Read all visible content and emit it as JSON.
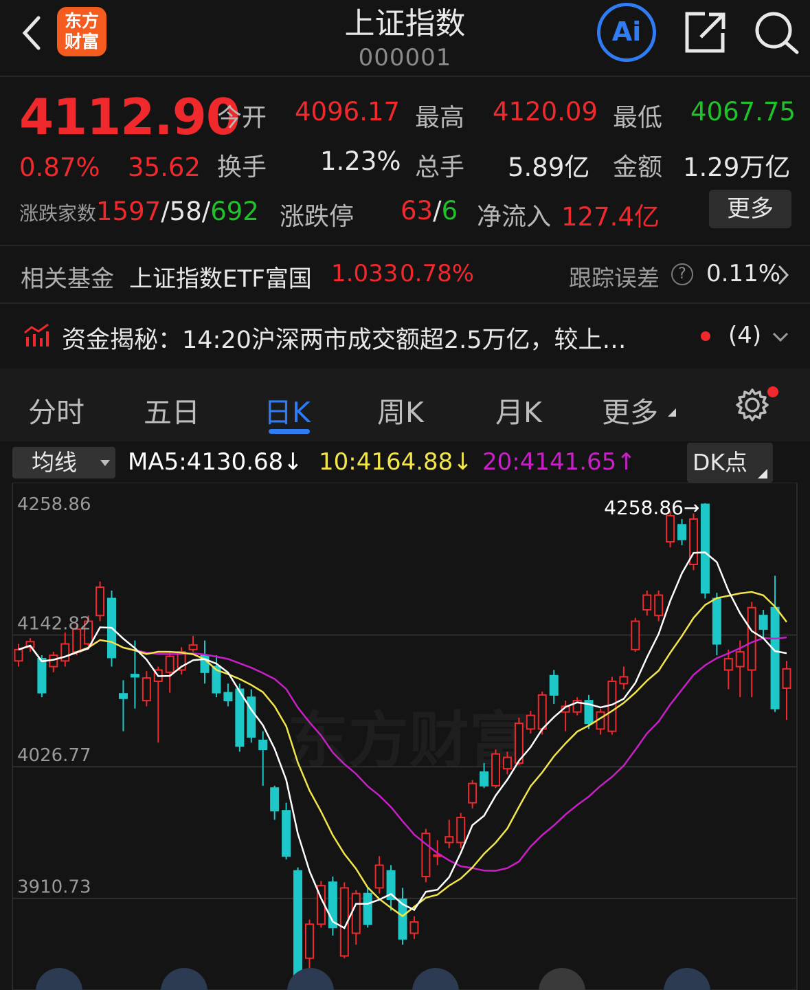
{
  "header": {
    "title": "上证指数",
    "code": "000001",
    "logo_line1": "东方",
    "logo_line2": "财富",
    "ai_label": "Ai"
  },
  "quote": {
    "price": "4112.90",
    "change_pct": "0.87%",
    "change": "35.62",
    "open_label": "今开",
    "open": "4096.17",
    "high_label": "最高",
    "high": "4120.09",
    "low_label": "最低",
    "low": "4067.75",
    "turnover_label": "换手",
    "turnover": "1.23%",
    "volume_label": "总手",
    "volume": "5.89亿",
    "amount_label": "金额",
    "amount": "1.29万亿",
    "breadth_label": "涨跌家数",
    "up_count": "1597",
    "flat_count": "58",
    "down_count": "692",
    "limit_label": "涨跌停",
    "limit_up": "63",
    "limit_down": "6",
    "netflow_label": "净流入",
    "netflow": "127.4亿",
    "more_label": "更多",
    "sep": "/"
  },
  "fund": {
    "label": "相关基金",
    "name": "上证指数ETF富国",
    "price": "1.033",
    "change": "0.78%",
    "tracking_label": "跟踪误差",
    "tracking_value": "0.11%"
  },
  "news": {
    "text": "资金揭秘：14:20沪深两市成交额超2.5万亿，较上…",
    "count": "(4)"
  },
  "tabs": [
    "分时",
    "五日",
    "日K",
    "周K",
    "月K",
    "更多"
  ],
  "active_tab": "日K",
  "indicators": {
    "selector_label": "均线",
    "ma5": "MA5:4130.68↓",
    "ma10": "10:4164.88↓",
    "ma20": "20:4141.65↑",
    "dk_label": "DK点"
  },
  "colors": {
    "up": "#f0292d",
    "down": "#1fc8c8",
    "ma5": "#ffffff",
    "ma10": "#f2e64a",
    "ma20": "#c81fc6",
    "accent": "#2f7cf4"
  },
  "chart_data": {
    "type": "candlestick",
    "y_ticks": [
      "4258.86",
      "4142.82",
      "4026.77",
      "3910.73"
    ],
    "max_marker": "4258.86",
    "ylim": [
      3830,
      4265
    ],
    "watermark": "东方财富",
    "candles": [
      {
        "o": 4120,
        "c": 4130,
        "h": 4135,
        "l": 4115
      },
      {
        "o": 4132,
        "c": 4137,
        "h": 4140,
        "l": 4128
      },
      {
        "o": 4122,
        "c": 4092,
        "h": 4125,
        "l": 4088
      },
      {
        "o": 4115,
        "c": 4125,
        "h": 4128,
        "l": 4110
      },
      {
        "o": 4120,
        "c": 4135,
        "h": 4145,
        "l": 4115
      },
      {
        "o": 4128,
        "c": 4148,
        "h": 4152,
        "l": 4125
      },
      {
        "o": 4135,
        "c": 4155,
        "h": 4160,
        "l": 4130
      },
      {
        "o": 4160,
        "c": 4185,
        "h": 4190,
        "l": 4155
      },
      {
        "o": 4175,
        "c": 4123,
        "h": 4182,
        "l": 4115
      },
      {
        "o": 4091,
        "c": 4087,
        "h": 4103,
        "l": 4058
      },
      {
        "o": 4108,
        "c": 4106,
        "h": 4138,
        "l": 4078
      },
      {
        "o": 4085,
        "c": 4105,
        "h": 4111,
        "l": 4080
      },
      {
        "o": 4102,
        "c": 4112,
        "h": 4115,
        "l": 4048
      },
      {
        "o": 4110,
        "c": 4124,
        "h": 4128,
        "l": 4092
      },
      {
        "o": 4112,
        "c": 4128,
        "h": 4132,
        "l": 4108
      },
      {
        "o": 4130,
        "c": 4134,
        "h": 4142,
        "l": 4128
      },
      {
        "o": 4125,
        "c": 4110,
        "h": 4138,
        "l": 4100
      },
      {
        "o": 4115,
        "c": 4092,
        "h": 4125,
        "l": 4088
      },
      {
        "o": 4092,
        "c": 4085,
        "h": 4100,
        "l": 4080
      },
      {
        "o": 4095,
        "c": 4045,
        "h": 4100,
        "l": 4040
      },
      {
        "o": 4088,
        "c": 4053,
        "h": 4095,
        "l": 4048
      },
      {
        "o": 4050,
        "c": 4042,
        "h": 4058,
        "l": 4010
      },
      {
        "o": 4008,
        "c": 3988,
        "h": 4010,
        "l": 3980
      },
      {
        "o": 3988,
        "c": 3948,
        "h": 3995,
        "l": 3945
      },
      {
        "o": 3935,
        "c": 3808,
        "h": 3938,
        "l": 3800
      },
      {
        "o": 3858,
        "c": 3888,
        "h": 3892,
        "l": 3825
      },
      {
        "o": 3888,
        "c": 3922,
        "h": 3926,
        "l": 3885
      },
      {
        "o": 3925,
        "c": 3885,
        "h": 3930,
        "l": 3878
      },
      {
        "o": 3860,
        "c": 3920,
        "h": 3925,
        "l": 3858
      },
      {
        "o": 3880,
        "c": 3915,
        "h": 3918,
        "l": 3870
      },
      {
        "o": 3915,
        "c": 3888,
        "h": 3920,
        "l": 3885
      },
      {
        "o": 3920,
        "c": 3940,
        "h": 3948,
        "l": 3915
      },
      {
        "o": 3935,
        "c": 3910,
        "h": 3940,
        "l": 3900
      },
      {
        "o": 3910,
        "c": 3875,
        "h": 3920,
        "l": 3870
      },
      {
        "o": 3880,
        "c": 3890,
        "h": 3895,
        "l": 3875
      },
      {
        "o": 3930,
        "c": 3968,
        "h": 3972,
        "l": 3925
      },
      {
        "o": 3948,
        "c": 3949,
        "h": 3962,
        "l": 3940
      },
      {
        "o": 3960,
        "c": 3965,
        "h": 3980,
        "l": 3955
      },
      {
        "o": 3960,
        "c": 3982,
        "h": 3986,
        "l": 3955
      },
      {
        "o": 3995,
        "c": 4012,
        "h": 4015,
        "l": 3990
      },
      {
        "o": 4022,
        "c": 4010,
        "h": 4030,
        "l": 4008
      },
      {
        "o": 4010,
        "c": 4038,
        "h": 4042,
        "l": 4008
      },
      {
        "o": 4025,
        "c": 4035,
        "h": 4040,
        "l": 4020
      },
      {
        "o": 4030,
        "c": 4065,
        "h": 4070,
        "l": 4028
      },
      {
        "o": 4060,
        "c": 4072,
        "h": 4076,
        "l": 4056
      },
      {
        "o": 4060,
        "c": 4090,
        "h": 4093,
        "l": 4055
      },
      {
        "o": 4107,
        "c": 4090,
        "h": 4112,
        "l": 4082
      },
      {
        "o": 4075,
        "c": 4080,
        "h": 4085,
        "l": 4058
      },
      {
        "o": 4075,
        "c": 4085,
        "h": 4088,
        "l": 4072
      },
      {
        "o": 4085,
        "c": 4065,
        "h": 4090,
        "l": 4060
      },
      {
        "o": 4060,
        "c": 4075,
        "h": 4078,
        "l": 4055
      },
      {
        "o": 4058,
        "c": 4102,
        "h": 4106,
        "l": 4055
      },
      {
        "o": 4100,
        "c": 4106,
        "h": 4115,
        "l": 4095
      },
      {
        "o": 4130,
        "c": 4155,
        "h": 4158,
        "l": 4128
      },
      {
        "o": 4165,
        "c": 4178,
        "h": 4182,
        "l": 4160
      },
      {
        "o": 4160,
        "c": 4178,
        "h": 4182,
        "l": 4155
      },
      {
        "o": 4225,
        "c": 4248,
        "h": 4252,
        "l": 4220
      },
      {
        "o": 4240,
        "c": 4227,
        "h": 4245,
        "l": 4222
      },
      {
        "o": 4205,
        "c": 4245,
        "h": 4250,
        "l": 4200
      },
      {
        "o": 4258,
        "c": 4180,
        "h": 4259,
        "l": 4175
      },
      {
        "o": 4175,
        "c": 4135,
        "h": 4180,
        "l": 4125
      },
      {
        "o": 4112,
        "c": 4122,
        "h": 4130,
        "l": 4095
      },
      {
        "o": 4115,
        "c": 4128,
        "h": 4138,
        "l": 4088
      },
      {
        "o": 4112,
        "c": 4167,
        "h": 4172,
        "l": 4088
      },
      {
        "o": 4160,
        "c": 4148,
        "h": 4165,
        "l": 4140
      },
      {
        "o": 4167,
        "c": 4078,
        "h": 4195,
        "l": 4075
      },
      {
        "o": 4096,
        "c": 4113,
        "h": 4120,
        "l": 4068
      }
    ],
    "ma5": [
      4115,
      4122,
      4125,
      4120,
      4127,
      4130,
      4135,
      4155,
      4160,
      4140,
      4130,
      4120,
      4108,
      4108,
      4120,
      4127,
      4125,
      4118,
      4105,
      4085,
      4060,
      4020,
      3970,
      3915,
      3880,
      3870,
      3875,
      3890,
      3900,
      3905,
      3905,
      3905,
      3895,
      3890,
      3900,
      3930,
      3945,
      3968,
      3985,
      4010,
      4030,
      4050,
      4060,
      4068,
      4075,
      4078,
      4078,
      4080,
      4085,
      4095,
      4112,
      4130,
      4160,
      4190,
      4215,
      4230,
      4232,
      4215,
      4195,
      4170,
      4148,
      4135,
      4125,
      4125
    ]
  },
  "bottom_icons": [
    "draw-line-icon",
    "draw-line-icon-2",
    "plus-icon",
    "pen-icon",
    "arrow-right-icon",
    "expand-icon"
  ]
}
